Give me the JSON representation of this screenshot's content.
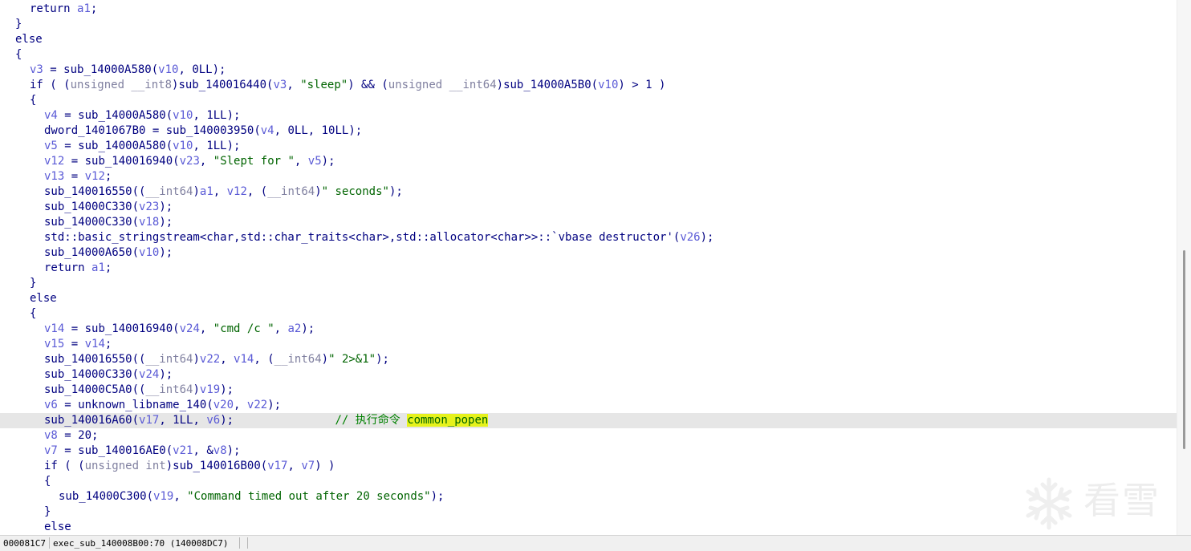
{
  "editor": {
    "lines": [
      {
        "id": "l01",
        "indent": 1,
        "tokens": [
          {
            "t": "return ",
            "c": "kw"
          },
          {
            "t": "a1",
            "c": "var"
          },
          {
            "t": ";",
            "c": "op"
          }
        ]
      },
      {
        "id": "l02",
        "indent": 0,
        "tokens": [
          {
            "t": "}",
            "c": "op"
          }
        ]
      },
      {
        "id": "l03",
        "indent": 0,
        "tokens": [
          {
            "t": "else",
            "c": "kw"
          }
        ]
      },
      {
        "id": "l04",
        "indent": 0,
        "tokens": [
          {
            "t": "{",
            "c": "op"
          }
        ]
      },
      {
        "id": "l05",
        "indent": 1,
        "tokens": [
          {
            "t": "v3",
            "c": "var"
          },
          {
            "t": " = ",
            "c": "op"
          },
          {
            "t": "sub_14000A580",
            "c": "fn"
          },
          {
            "t": "(",
            "c": "op"
          },
          {
            "t": "v10",
            "c": "var"
          },
          {
            "t": ", ",
            "c": "op"
          },
          {
            "t": "0LL",
            "c": "num"
          },
          {
            "t": ");",
            "c": "op"
          }
        ]
      },
      {
        "id": "l06",
        "indent": 1,
        "tokens": [
          {
            "t": "if ( (",
            "c": "kw"
          },
          {
            "t": "unsigned __int8",
            "c": "type"
          },
          {
            "t": ")",
            "c": "op"
          },
          {
            "t": "sub_140016440",
            "c": "fn"
          },
          {
            "t": "(",
            "c": "op"
          },
          {
            "t": "v3",
            "c": "var"
          },
          {
            "t": ", ",
            "c": "op"
          },
          {
            "t": "\"sleep\"",
            "c": "str"
          },
          {
            "t": ") && (",
            "c": "op"
          },
          {
            "t": "unsigned __int64",
            "c": "type"
          },
          {
            "t": ")",
            "c": "op"
          },
          {
            "t": "sub_14000A5B0",
            "c": "fn"
          },
          {
            "t": "(",
            "c": "op"
          },
          {
            "t": "v10",
            "c": "var"
          },
          {
            "t": ") > 1 )",
            "c": "op"
          }
        ]
      },
      {
        "id": "l07",
        "indent": 1,
        "tokens": [
          {
            "t": "{",
            "c": "op"
          }
        ]
      },
      {
        "id": "l08",
        "indent": 2,
        "tokens": [
          {
            "t": "v4",
            "c": "var"
          },
          {
            "t": " = ",
            "c": "op"
          },
          {
            "t": "sub_14000A580",
            "c": "fn"
          },
          {
            "t": "(",
            "c": "op"
          },
          {
            "t": "v10",
            "c": "var"
          },
          {
            "t": ", ",
            "c": "op"
          },
          {
            "t": "1LL",
            "c": "num"
          },
          {
            "t": ");",
            "c": "op"
          }
        ]
      },
      {
        "id": "l09",
        "indent": 2,
        "tokens": [
          {
            "t": "dword_1401067B0",
            "c": "fn"
          },
          {
            "t": " = ",
            "c": "op"
          },
          {
            "t": "sub_140003950",
            "c": "fn"
          },
          {
            "t": "(",
            "c": "op"
          },
          {
            "t": "v4",
            "c": "var"
          },
          {
            "t": ", ",
            "c": "op"
          },
          {
            "t": "0LL",
            "c": "num"
          },
          {
            "t": ", ",
            "c": "op"
          },
          {
            "t": "10LL",
            "c": "num"
          },
          {
            "t": ");",
            "c": "op"
          }
        ]
      },
      {
        "id": "l10",
        "indent": 2,
        "tokens": [
          {
            "t": "v5",
            "c": "var"
          },
          {
            "t": " = ",
            "c": "op"
          },
          {
            "t": "sub_14000A580",
            "c": "fn"
          },
          {
            "t": "(",
            "c": "op"
          },
          {
            "t": "v10",
            "c": "var"
          },
          {
            "t": ", ",
            "c": "op"
          },
          {
            "t": "1LL",
            "c": "num"
          },
          {
            "t": ");",
            "c": "op"
          }
        ]
      },
      {
        "id": "l11",
        "indent": 2,
        "tokens": [
          {
            "t": "v12",
            "c": "var"
          },
          {
            "t": " = ",
            "c": "op"
          },
          {
            "t": "sub_140016940",
            "c": "fn"
          },
          {
            "t": "(",
            "c": "op"
          },
          {
            "t": "v23",
            "c": "var"
          },
          {
            "t": ", ",
            "c": "op"
          },
          {
            "t": "\"Slept for \"",
            "c": "str"
          },
          {
            "t": ", ",
            "c": "op"
          },
          {
            "t": "v5",
            "c": "var"
          },
          {
            "t": ");",
            "c": "op"
          }
        ]
      },
      {
        "id": "l12",
        "indent": 2,
        "tokens": [
          {
            "t": "v13",
            "c": "var"
          },
          {
            "t": " = ",
            "c": "op"
          },
          {
            "t": "v12",
            "c": "var"
          },
          {
            "t": ";",
            "c": "op"
          }
        ]
      },
      {
        "id": "l13",
        "indent": 2,
        "tokens": [
          {
            "t": "sub_140016550",
            "c": "fn"
          },
          {
            "t": "((",
            "c": "op"
          },
          {
            "t": "__int64",
            "c": "type"
          },
          {
            "t": ")",
            "c": "op"
          },
          {
            "t": "a1",
            "c": "var"
          },
          {
            "t": ", ",
            "c": "op"
          },
          {
            "t": "v12",
            "c": "var"
          },
          {
            "t": ", (",
            "c": "op"
          },
          {
            "t": "__int64",
            "c": "type"
          },
          {
            "t": ")",
            "c": "op"
          },
          {
            "t": "\" seconds\"",
            "c": "str"
          },
          {
            "t": ");",
            "c": "op"
          }
        ]
      },
      {
        "id": "l14",
        "indent": 2,
        "tokens": [
          {
            "t": "sub_14000C330",
            "c": "fn"
          },
          {
            "t": "(",
            "c": "op"
          },
          {
            "t": "v23",
            "c": "var"
          },
          {
            "t": ");",
            "c": "op"
          }
        ]
      },
      {
        "id": "l15",
        "indent": 2,
        "tokens": [
          {
            "t": "sub_14000C330",
            "c": "fn"
          },
          {
            "t": "(",
            "c": "op"
          },
          {
            "t": "v18",
            "c": "var"
          },
          {
            "t": ");",
            "c": "op"
          }
        ]
      },
      {
        "id": "l16",
        "indent": 2,
        "tokens": [
          {
            "t": "std::basic_stringstream<char,std::char_traits<char>,std::allocator<char>>::`vbase destructor'",
            "c": "fn"
          },
          {
            "t": "(",
            "c": "op"
          },
          {
            "t": "v26",
            "c": "var"
          },
          {
            "t": ");",
            "c": "op"
          }
        ]
      },
      {
        "id": "l17",
        "indent": 2,
        "tokens": [
          {
            "t": "sub_14000A650",
            "c": "fn"
          },
          {
            "t": "(",
            "c": "op"
          },
          {
            "t": "v10",
            "c": "var"
          },
          {
            "t": ");",
            "c": "op"
          }
        ]
      },
      {
        "id": "l18",
        "indent": 2,
        "tokens": [
          {
            "t": "return ",
            "c": "kw"
          },
          {
            "t": "a1",
            "c": "var"
          },
          {
            "t": ";",
            "c": "op"
          }
        ]
      },
      {
        "id": "l19",
        "indent": 1,
        "tokens": [
          {
            "t": "}",
            "c": "op"
          }
        ]
      },
      {
        "id": "l20",
        "indent": 1,
        "tokens": [
          {
            "t": "else",
            "c": "kw"
          }
        ]
      },
      {
        "id": "l21",
        "indent": 1,
        "tokens": [
          {
            "t": "{",
            "c": "op"
          }
        ]
      },
      {
        "id": "l22",
        "indent": 2,
        "tokens": [
          {
            "t": "v14",
            "c": "var"
          },
          {
            "t": " = ",
            "c": "op"
          },
          {
            "t": "sub_140016940",
            "c": "fn"
          },
          {
            "t": "(",
            "c": "op"
          },
          {
            "t": "v24",
            "c": "var"
          },
          {
            "t": ", ",
            "c": "op"
          },
          {
            "t": "\"cmd /c \"",
            "c": "str"
          },
          {
            "t": ", ",
            "c": "op"
          },
          {
            "t": "a2",
            "c": "var"
          },
          {
            "t": ");",
            "c": "op"
          }
        ]
      },
      {
        "id": "l23",
        "indent": 2,
        "tokens": [
          {
            "t": "v15",
            "c": "var"
          },
          {
            "t": " = ",
            "c": "op"
          },
          {
            "t": "v14",
            "c": "var"
          },
          {
            "t": ";",
            "c": "op"
          }
        ]
      },
      {
        "id": "l24",
        "indent": 2,
        "tokens": [
          {
            "t": "sub_140016550",
            "c": "fn"
          },
          {
            "t": "((",
            "c": "op"
          },
          {
            "t": "__int64",
            "c": "type"
          },
          {
            "t": ")",
            "c": "op"
          },
          {
            "t": "v22",
            "c": "var"
          },
          {
            "t": ", ",
            "c": "op"
          },
          {
            "t": "v14",
            "c": "var"
          },
          {
            "t": ", (",
            "c": "op"
          },
          {
            "t": "__int64",
            "c": "type"
          },
          {
            "t": ")",
            "c": "op"
          },
          {
            "t": "\" 2>&1\"",
            "c": "str"
          },
          {
            "t": ");",
            "c": "op"
          }
        ]
      },
      {
        "id": "l25",
        "indent": 2,
        "tokens": [
          {
            "t": "sub_14000C330",
            "c": "fn"
          },
          {
            "t": "(",
            "c": "op"
          },
          {
            "t": "v24",
            "c": "var"
          },
          {
            "t": ");",
            "c": "op"
          }
        ]
      },
      {
        "id": "l26",
        "indent": 2,
        "tokens": [
          {
            "t": "sub_14000C5A0",
            "c": "fn"
          },
          {
            "t": "((",
            "c": "op"
          },
          {
            "t": "__int64",
            "c": "type"
          },
          {
            "t": ")",
            "c": "op"
          },
          {
            "t": "v19",
            "c": "var"
          },
          {
            "t": ");",
            "c": "op"
          }
        ]
      },
      {
        "id": "l27",
        "indent": 2,
        "tokens": [
          {
            "t": "v6",
            "c": "var"
          },
          {
            "t": " = ",
            "c": "op"
          },
          {
            "t": "unknown_libname_140",
            "c": "fn"
          },
          {
            "t": "(",
            "c": "op"
          },
          {
            "t": "v20",
            "c": "var"
          },
          {
            "t": ", ",
            "c": "op"
          },
          {
            "t": "v22",
            "c": "var"
          },
          {
            "t": ");",
            "c": "op"
          }
        ]
      },
      {
        "id": "l28",
        "indent": 2,
        "current": true,
        "tokens": [
          {
            "t": "sub_140016A60",
            "c": "fn"
          },
          {
            "t": "(",
            "c": "op"
          },
          {
            "t": "v17",
            "c": "var"
          },
          {
            "t": ", ",
            "c": "op"
          },
          {
            "t": "1LL",
            "c": "num"
          },
          {
            "t": ", ",
            "c": "op"
          },
          {
            "t": "v6",
            "c": "var"
          },
          {
            "t": ");               ",
            "c": "op"
          },
          {
            "t": "// 执行命令 ",
            "c": "cm"
          },
          {
            "t": "caret",
            "c": "caret"
          },
          {
            "t": "common_popen",
            "c": "hl"
          }
        ]
      },
      {
        "id": "l29",
        "indent": 2,
        "tokens": [
          {
            "t": "v8",
            "c": "var"
          },
          {
            "t": " = ",
            "c": "op"
          },
          {
            "t": "20",
            "c": "num"
          },
          {
            "t": ";",
            "c": "op"
          }
        ]
      },
      {
        "id": "l30",
        "indent": 2,
        "tokens": [
          {
            "t": "v7",
            "c": "var"
          },
          {
            "t": " = ",
            "c": "op"
          },
          {
            "t": "sub_140016AE0",
            "c": "fn"
          },
          {
            "t": "(",
            "c": "op"
          },
          {
            "t": "v21",
            "c": "var"
          },
          {
            "t": ", &",
            "c": "op"
          },
          {
            "t": "v8",
            "c": "var"
          },
          {
            "t": ");",
            "c": "op"
          }
        ]
      },
      {
        "id": "l31",
        "indent": 2,
        "tokens": [
          {
            "t": "if ( (",
            "c": "kw"
          },
          {
            "t": "unsigned int",
            "c": "type"
          },
          {
            "t": ")",
            "c": "op"
          },
          {
            "t": "sub_140016B00",
            "c": "fn"
          },
          {
            "t": "(",
            "c": "op"
          },
          {
            "t": "v17",
            "c": "var"
          },
          {
            "t": ", ",
            "c": "op"
          },
          {
            "t": "v7",
            "c": "var"
          },
          {
            "t": ") )",
            "c": "op"
          }
        ]
      },
      {
        "id": "l32",
        "indent": 2,
        "tokens": [
          {
            "t": "{",
            "c": "op"
          }
        ]
      },
      {
        "id": "l33",
        "indent": 3,
        "tokens": [
          {
            "t": "sub_14000C300",
            "c": "fn"
          },
          {
            "t": "(",
            "c": "op"
          },
          {
            "t": "v19",
            "c": "var"
          },
          {
            "t": ", ",
            "c": "op"
          },
          {
            "t": "\"Command timed out after 20 seconds\"",
            "c": "str"
          },
          {
            "t": ");",
            "c": "op"
          }
        ]
      },
      {
        "id": "l34",
        "indent": 2,
        "tokens": [
          {
            "t": "}",
            "c": "op"
          }
        ]
      },
      {
        "id": "l35",
        "indent": 2,
        "tokens": [
          {
            "t": "else",
            "c": "kw"
          }
        ]
      }
    ]
  },
  "status": {
    "address": "000081C7",
    "location": "exec_sub_140008B00:70 (140008DC7)"
  },
  "watermark": {
    "icon": "snowflake-icon",
    "text": "看雪"
  },
  "colors": {
    "highlight": "#e6f21c",
    "current_line": "#e6e6e6",
    "string": "#006400",
    "comment": "#008000",
    "variable": "#5a5ad6"
  }
}
